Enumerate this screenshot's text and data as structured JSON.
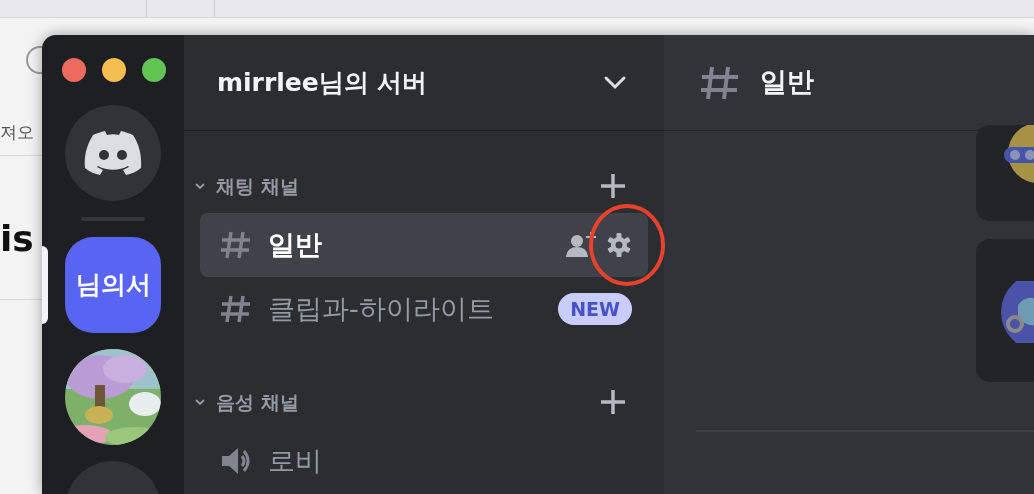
{
  "background_page": {
    "texts": [
      "져오",
      "is"
    ]
  },
  "server_rail": {
    "servers": [
      {
        "kind": "home",
        "selected": false
      },
      {
        "kind": "text",
        "label": "님의서",
        "selected": true
      },
      {
        "kind": "picture",
        "selected": false
      },
      {
        "kind": "blank",
        "selected": false
      }
    ]
  },
  "server_header": {
    "title": "mirrlee님의 서버"
  },
  "categories": [
    {
      "name": "채팅 채널",
      "expanded": true,
      "channels": [
        {
          "kind": "text",
          "name": "일반",
          "selected": true
        },
        {
          "kind": "text",
          "name": "클립과-하이라이트",
          "selected": false,
          "badge": "NEW"
        }
      ]
    },
    {
      "name": "음성 채널",
      "expanded": true,
      "channels": [
        {
          "kind": "voice",
          "name": "로비",
          "selected": false
        }
      ]
    }
  ],
  "channel_header": {
    "name": "일반"
  }
}
